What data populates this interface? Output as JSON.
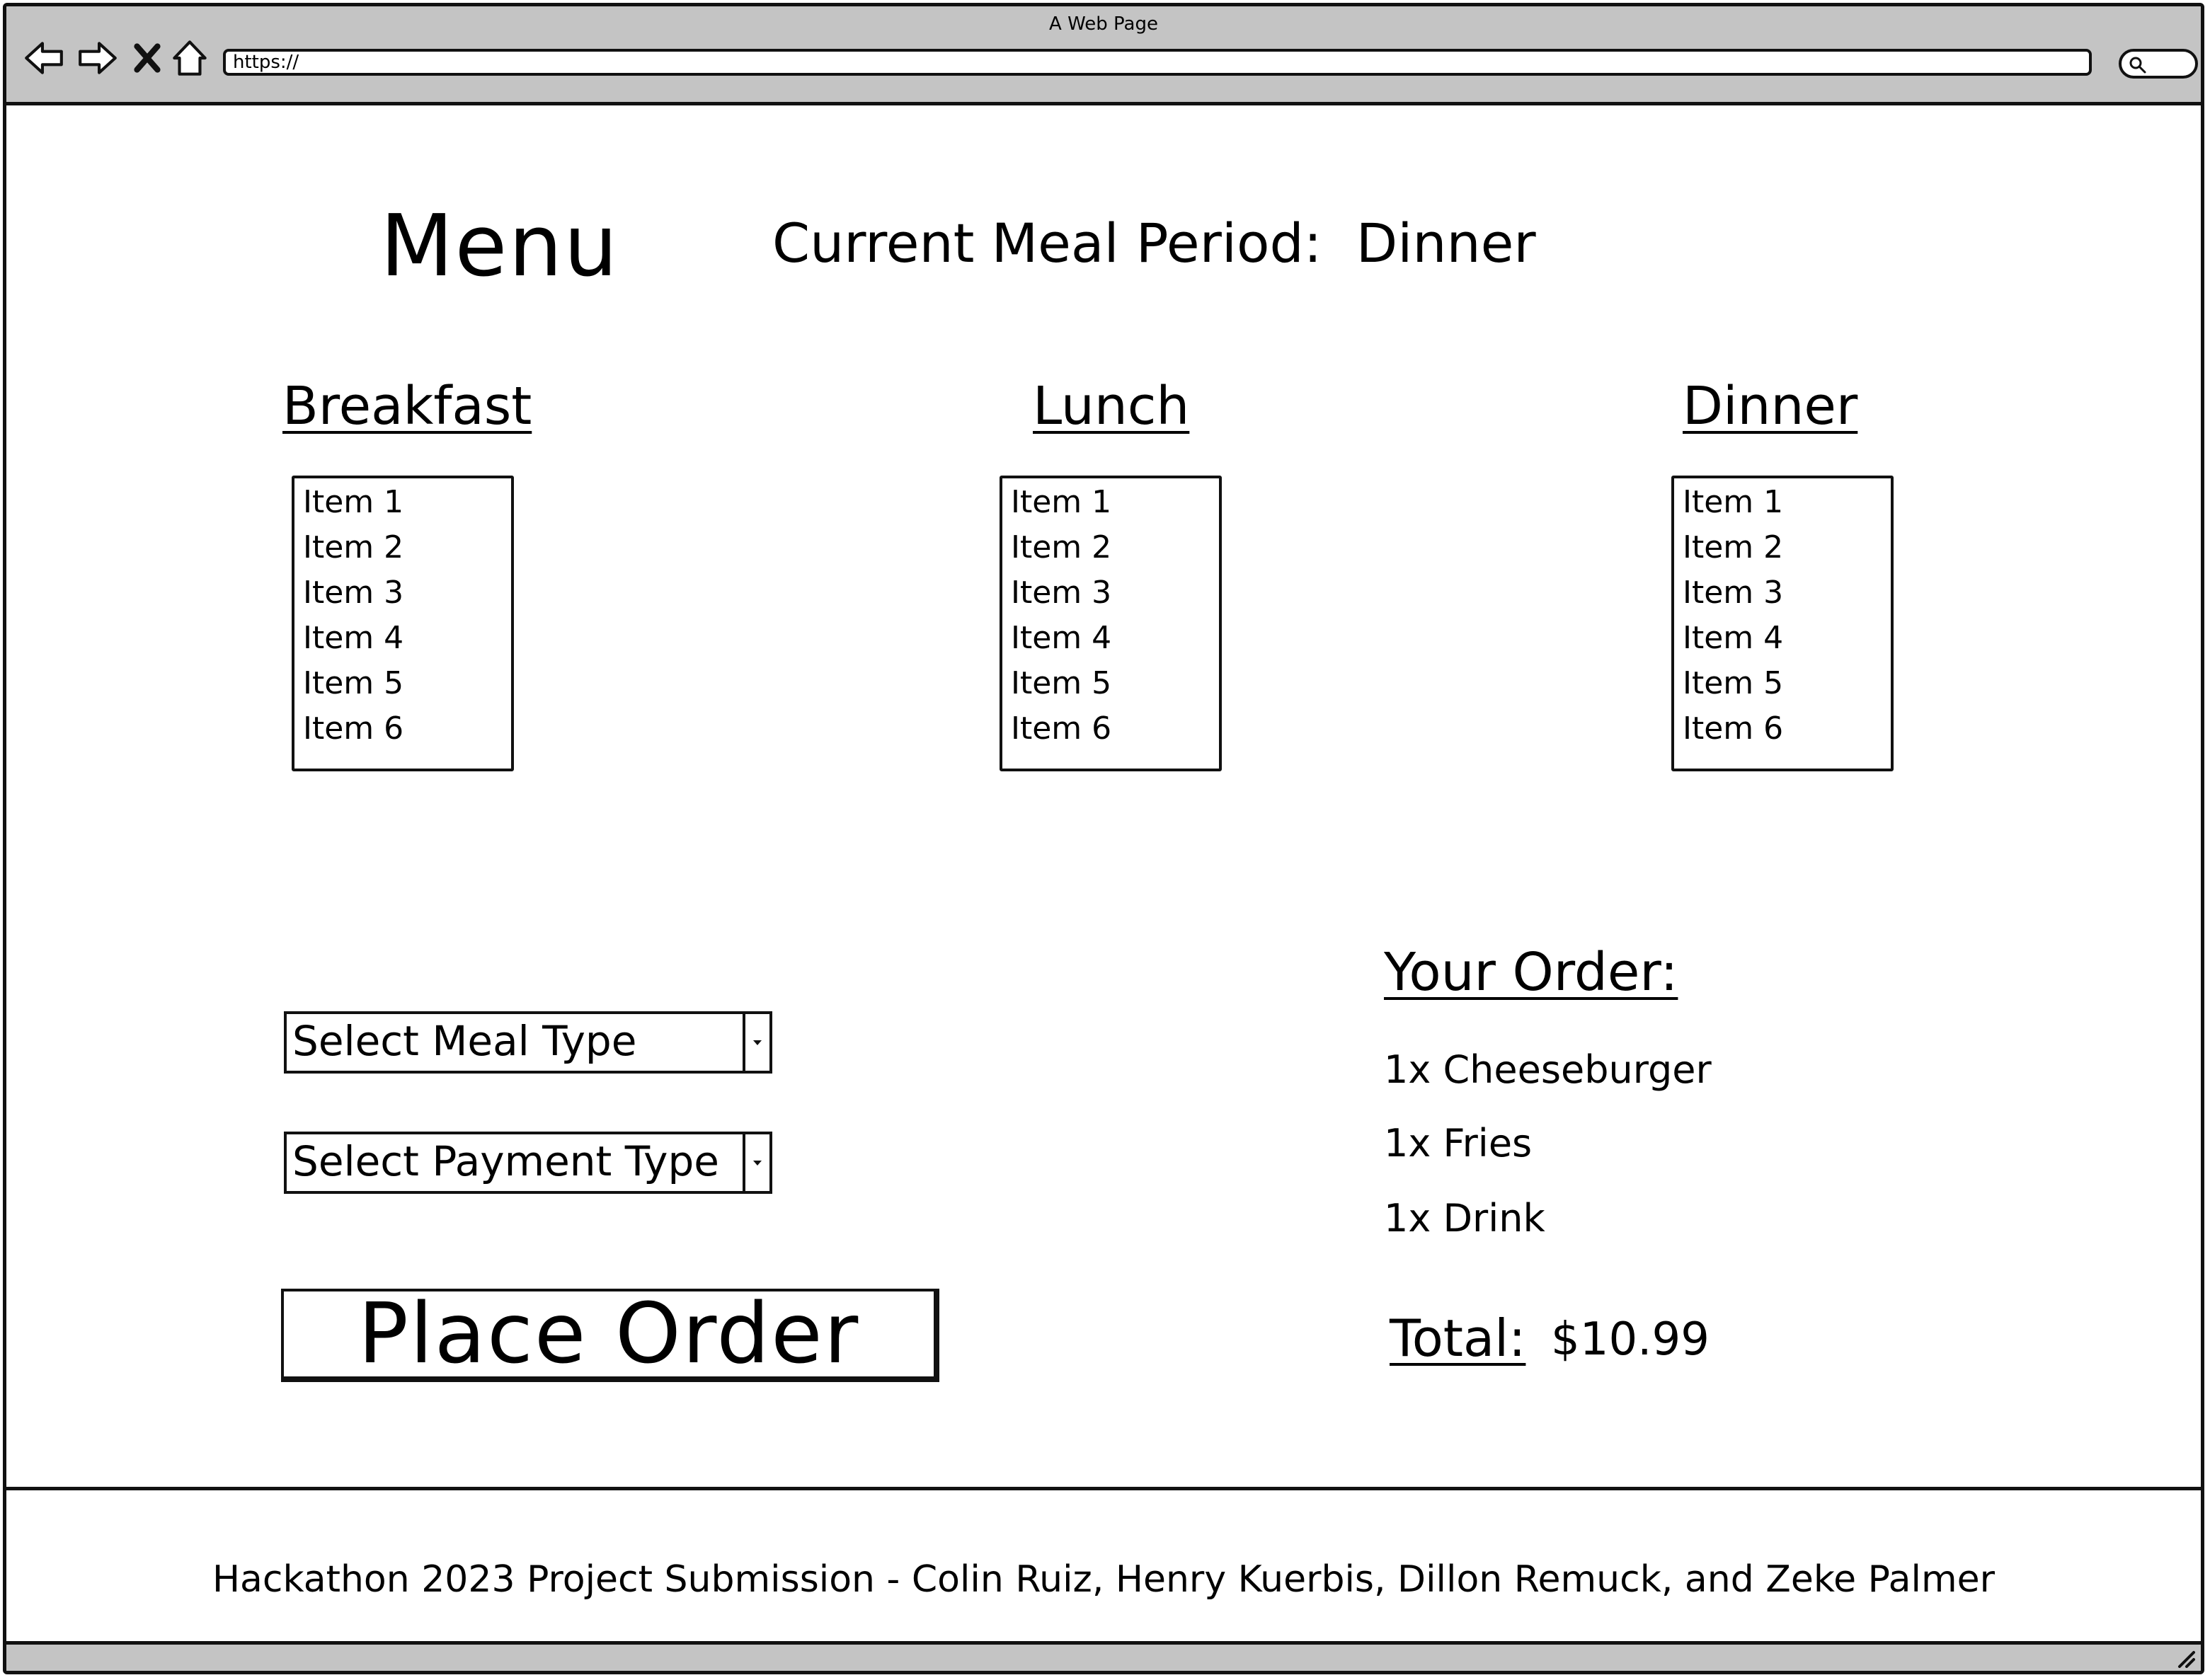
{
  "window": {
    "title": "A Web Page",
    "url": "https://"
  },
  "header": {
    "menu_title": "Menu",
    "meal_period_label": "Current Meal Period:",
    "meal_period_value": "Dinner"
  },
  "columns": [
    {
      "heading": "Breakfast",
      "items": [
        "Item 1",
        "Item 2",
        "Item 3",
        "Item 4",
        "Item 5",
        "Item 6"
      ]
    },
    {
      "heading": "Lunch",
      "items": [
        "Item 1",
        "Item 2",
        "Item 3",
        "Item 4",
        "Item 5",
        "Item 6"
      ]
    },
    {
      "heading": "Dinner",
      "items": [
        "Item 1",
        "Item 2",
        "Item 3",
        "Item 4",
        "Item 5",
        "Item 6"
      ]
    }
  ],
  "controls": {
    "meal_type_select": "Select Meal Type",
    "payment_type_select": "Select Payment Type",
    "place_order_button": "Place Order"
  },
  "order": {
    "heading": "Your Order:",
    "items": [
      "1x Cheeseburger",
      "1x Fries",
      "1x Drink"
    ],
    "total_label": "Total:",
    "total_value": "$10.99"
  },
  "footer": {
    "text": "Hackathon 2023 Project Submission - Colin Ruiz, Henry Kuerbis, Dillon Remuck, and Zeke Palmer"
  },
  "icons": [
    "back-icon",
    "forward-icon",
    "stop-icon",
    "home-icon",
    "search-icon",
    "resize-grip-icon",
    "chevron-down-icon"
  ],
  "colors": {
    "chrome": "#c4c4c4",
    "ink": "#111111",
    "background": "#ffffff"
  }
}
